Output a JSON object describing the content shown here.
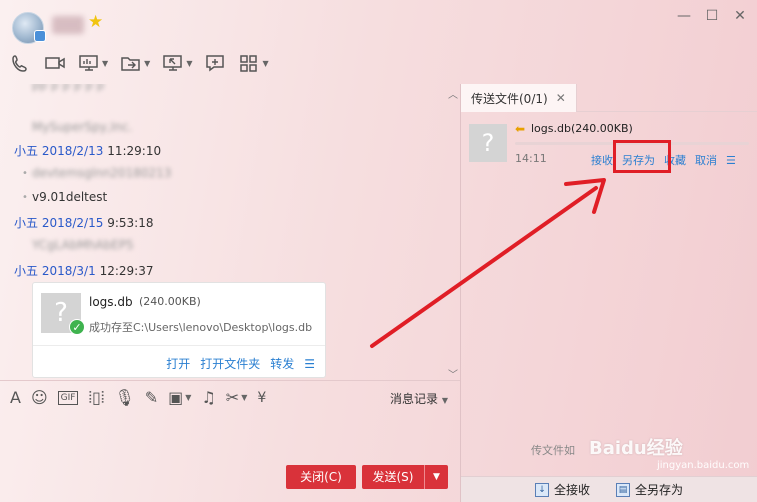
{
  "header": {
    "contact_name_blurred": "小五"
  },
  "chat": {
    "messages": [
      {
        "text_blurred": "MySuperSpy,Inc."
      },
      {
        "sender": "小五",
        "date": "2018/2/13",
        "time": "11:29:10"
      },
      {
        "text_blurred": "devtemsglnn20180213"
      },
      {
        "text": "v9.01deltest"
      },
      {
        "sender": "小五",
        "date": "2018/2/15",
        "time": "9:53:18"
      },
      {
        "text_blurred": "YCgLAbMhAbEP5"
      },
      {
        "sender": "小五",
        "date": "2018/3/1",
        "time": "12:29:37"
      }
    ],
    "file_card": {
      "name": "logs.db",
      "size": "(240.00KB)",
      "status": "成功存至C:\\Users\\lenovo\\Desktop\\logs.db",
      "actions": [
        "打开",
        "打开文件夹",
        "转发"
      ]
    }
  },
  "input_toolbar": {
    "history_label": "消息记录",
    "icons": [
      "font-icon",
      "emoji-icon",
      "gif-icon",
      "shake-icon",
      "voice-icon",
      "pen-icon",
      "image-icon",
      "music-icon",
      "scissors-icon",
      "red-packet-icon"
    ]
  },
  "buttons": {
    "close": "关闭(C)",
    "send": "发送(S)"
  },
  "transfer": {
    "tab_title": "传送文件(0/1)",
    "file_name": "logs.db(240.00KB)",
    "time": "14:11",
    "progress": 0,
    "actions": [
      "接收",
      "另存为",
      "收藏",
      "取消"
    ],
    "footer_text": "传文件如",
    "watermark": "Baidu经验",
    "watermark_sub": "jingyan.baidu.com",
    "bottom_actions": [
      "全接收",
      "全另存为"
    ]
  }
}
